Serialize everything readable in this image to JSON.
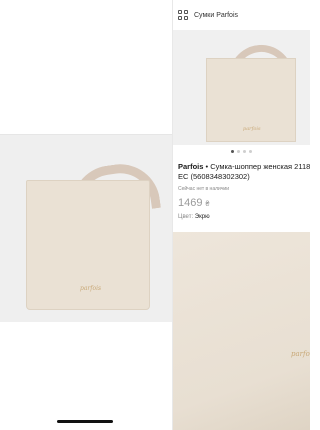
{
  "header": {
    "breadcrumb": "Сумки Parfois",
    "grid_icon": "grid-icon"
  },
  "product": {
    "brand": "Parfois",
    "separator": " • ",
    "title": "Сумка-шоппер женская 2118",
    "code_line": "ЕС (5608348302302)",
    "availability": "Сейчас нет в наличии",
    "price": "1469",
    "currency": "₴",
    "color_label": "Цвет:",
    "color_value": "Экрю"
  },
  "gallery": {
    "total_dots": 4,
    "active_dot": 1,
    "logo_text": "parfois"
  },
  "colors": {
    "bag": "#eae1d4",
    "handle": "#d8c8ba",
    "logo": "#c9a978",
    "background": "#efefef"
  }
}
